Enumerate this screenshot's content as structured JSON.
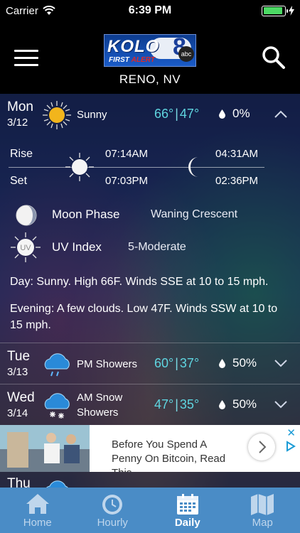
{
  "status_bar": {
    "carrier": "Carrier",
    "time": "6:39 PM",
    "battery_level": 0.9
  },
  "header": {
    "logo_text": "KOLO",
    "logo_number": "8",
    "logo_network": "abc",
    "logo_sub_first": "FIRST",
    "logo_sub_alert": "ALERT",
    "location": "RENO, NV"
  },
  "today": {
    "day": "Mon",
    "date": "3/12",
    "condition": "Sunny",
    "high": "66°",
    "low": "47°",
    "separator": "|",
    "precip": "0%",
    "icon": "sun-icon",
    "rise_label": "Rise",
    "set_label": "Set",
    "sunrise": "07:14AM",
    "sunset": "07:03PM",
    "moonrise": "04:31AM",
    "moonset": "02:36PM",
    "moon_phase_label": "Moon Phase",
    "moon_phase_value": "Waning Crescent",
    "uv_label": "UV Index",
    "uv_value": "5-Moderate",
    "uv_badge": "UV",
    "day_label": "Day",
    "day_text": ": Sunny. High 66F. Winds SSE at 10 to 15 mph.",
    "evening_label": "Evening",
    "evening_text": ": A few clouds. Low 47F. Winds SSW at 10 to 15 mph."
  },
  "days": [
    {
      "day": "Tue",
      "date": "3/13",
      "condition": "PM Showers",
      "high": "60°",
      "low": "37°",
      "precip": "50%",
      "icon": "rain-cloud-icon"
    },
    {
      "day": "Wed",
      "date": "3/14",
      "condition": "AM Snow Showers",
      "high": "47°",
      "low": "35°",
      "precip": "50%",
      "icon": "snow-cloud-icon"
    },
    {
      "day": "Thu",
      "icon": "cloud-icon"
    }
  ],
  "ad": {
    "text": "Before You Spend A Penny On Bitcoin, Read This"
  },
  "tabs": [
    {
      "label": "Home",
      "icon": "home-icon"
    },
    {
      "label": "Hourly",
      "icon": "clock-icon"
    },
    {
      "label": "Daily",
      "icon": "calendar-icon",
      "active": true
    },
    {
      "label": "Map",
      "icon": "map-icon"
    }
  ],
  "colors": {
    "temp": "#5fd5e0",
    "tabbar": "#4a8cc6",
    "battery": "#4cd964"
  }
}
